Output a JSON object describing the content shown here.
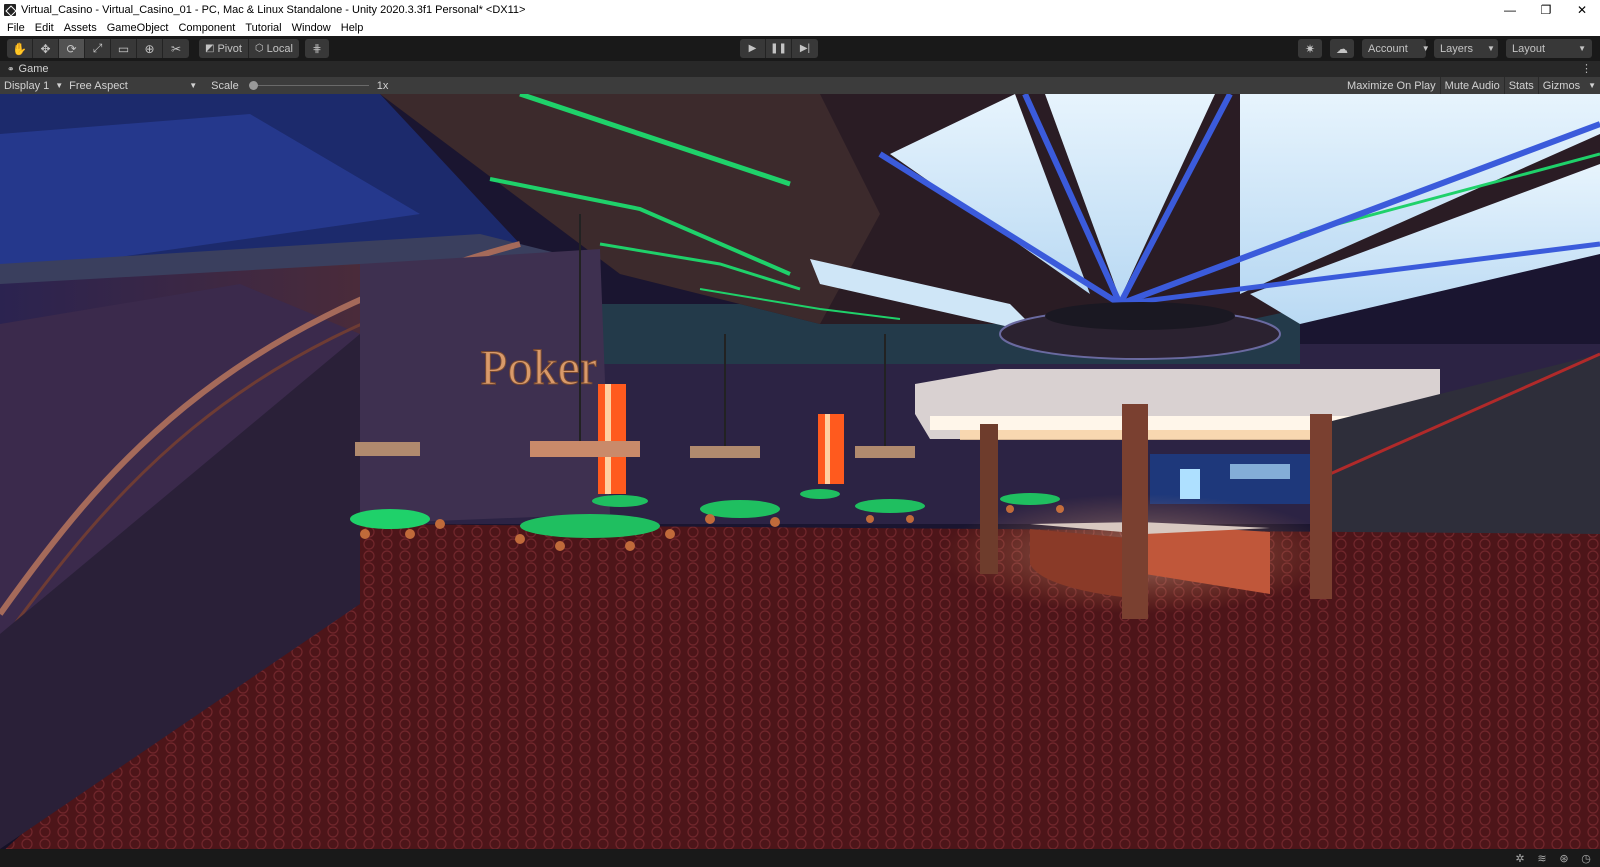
{
  "window": {
    "title": "Virtual_Casino - Virtual_Casino_01 - PC, Mac & Linux Standalone - Unity 2020.3.3f1 Personal* <DX11>",
    "minimize": "—",
    "restore": "❐",
    "close": "✕"
  },
  "menu": [
    "File",
    "Edit",
    "Assets",
    "GameObject",
    "Component",
    "Tutorial",
    "Window",
    "Help"
  ],
  "toolbar": {
    "tools": [
      {
        "name": "hand-tool",
        "glyph": "✋"
      },
      {
        "name": "move-tool",
        "glyph": "✥"
      },
      {
        "name": "rotate-tool",
        "glyph": "⟳"
      },
      {
        "name": "scale-tool",
        "glyph": "⤢"
      },
      {
        "name": "rect-tool",
        "glyph": "▭"
      },
      {
        "name": "transform-tool",
        "glyph": "⊕"
      },
      {
        "name": "custom-tool",
        "glyph": "✂"
      }
    ],
    "pivot_label": "Pivot",
    "local_label": "Local",
    "grid_glyph": "⋕",
    "play_glyph": "▶",
    "pause_glyph": "❚❚",
    "step_glyph": "▶|",
    "collab_glyph": "✷",
    "cloud_glyph": "☁",
    "account_label": "Account",
    "layers_label": "Layers",
    "layout_label": "Layout"
  },
  "tab": {
    "label": "Game",
    "menu_glyph": "⋮"
  },
  "gamebar": {
    "display": "Display 1",
    "aspect": "Free Aspect",
    "scale_label": "Scale",
    "scale_value": "1x",
    "scale_fraction": 0.0,
    "maximize": "Maximize On Play",
    "mute": "Mute Audio",
    "stats": "Stats",
    "gizmos": "Gizmos"
  },
  "scene": {
    "poker_sign": "Poker",
    "colors": {
      "carpet": "#5a1a1e",
      "ceiling_glow": "#d8eefb",
      "neon_green": "#1fd16a",
      "neon_orange": "#ff5a1e",
      "wall_purple": "#3a2a55"
    }
  }
}
